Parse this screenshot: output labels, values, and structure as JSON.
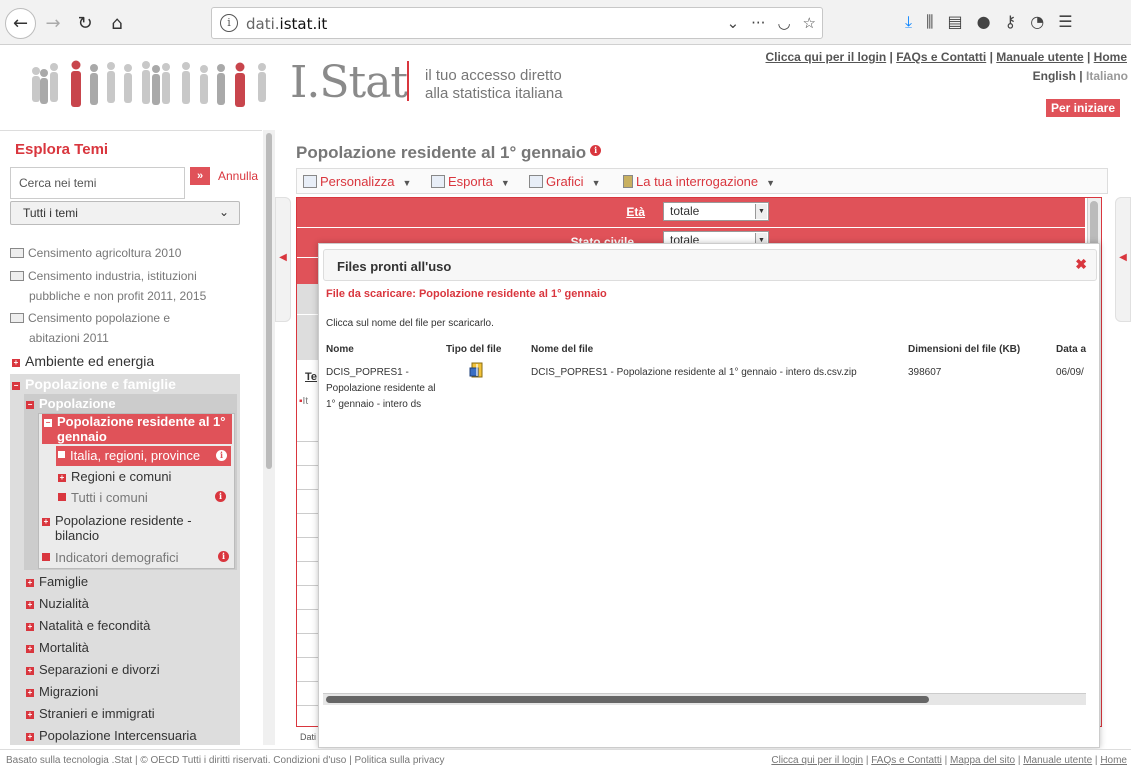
{
  "browser": {
    "url_prefix": "dati.",
    "url_domain": "istat.it",
    "url_icons": [
      "chevron-down-icon",
      "ellipsis-icon",
      "pocket-icon",
      "star-icon"
    ],
    "toolbar_icons": [
      "download-icon",
      "library-icon",
      "sidebar-icon",
      "extension-icon",
      "key-icon",
      "speedometer-icon",
      "menu-icon"
    ]
  },
  "header": {
    "logo": "I.Stat",
    "tagline_line1": "il tuo accesso diretto",
    "tagline_line2": "alla statistica italiana",
    "top_links": [
      "Clicca qui per il login",
      "FAQs e Contatti",
      "Manuale utente",
      "Home"
    ],
    "lang_en": "English",
    "lang_it": "Italiano",
    "start_button": "Per iniziare"
  },
  "sidebar": {
    "title": "Esplora Temi",
    "search_placeholder": "Cerca nei temi",
    "go_label": "»",
    "cancel_label": "Annulla",
    "select_value": "Tutti i temi",
    "census": [
      "Censimento agricoltura 2010",
      "Censimento industria, istituzioni",
      "pubbliche e non profit 2011, 2015",
      "Censimento popolazione e",
      "abitazioni 2011"
    ],
    "topics": {
      "ambiente": "Ambiente ed energia",
      "popolazione_famiglie": "Popolazione e famiglie",
      "popolazione": "Popolazione",
      "pop_residente": "Popolazione residente al 1°",
      "pop_residente_2": "gennaio",
      "italia": "Italia, regioni, province",
      "regioni": "Regioni e comuni",
      "comuni": "Tutti i comuni",
      "bilancio_1": "Popolazione residente -",
      "bilancio_2": "bilancio",
      "indicatori": "Indicatori demografici",
      "famiglie": "Famiglie",
      "nuzialita": "Nuzialità",
      "natalita": "Natalità e fecondità",
      "mortalita": "Mortalità",
      "separazioni": "Separazioni e divorzi",
      "migrazioni": "Migrazioni",
      "stranieri": "Stranieri e immigrati",
      "intercensuaria": "Popolazione Intercensuaria"
    }
  },
  "main": {
    "title": "Popolazione residente al 1° gennaio",
    "tools": [
      "Personalizza",
      "Esporta",
      "Grafici",
      "La tua interrogazione"
    ],
    "dim1_label": "Età",
    "dim1_value": "totale",
    "dim2_label": "Stato civile",
    "dim2_value": "totale",
    "partial_te": "Te",
    "partial_it": "It",
    "footnote": "Dati"
  },
  "modal": {
    "title": "Files pronti all'uso",
    "close": "✖",
    "subtitle": "File da scaricare: Popolazione residente al 1° gennaio",
    "hint": "Clicca sul nome del file per scaricarlo.",
    "columns": [
      "Nome",
      "Tipo del file",
      "Nome del file",
      "Dimensioni del file (KB)",
      "Data a"
    ],
    "rows": [
      {
        "name": "DCIS_POPRES1 - Popolazione residente al 1° gennaio - intero ds",
        "file_name": "DCIS_POPRES1 - Popolazione residente al 1° gennaio - intero ds.csv.zip",
        "size_kb": "398607",
        "date": "06/09/"
      }
    ]
  },
  "footer": {
    "left": "Basato sulla tecnologia .Stat | © OECD Tutti i diritti riservati. Condizioni d'uso |  Politica sulla privacy",
    "right_links": [
      "Clicca qui per il login",
      "FAQs e Contatti",
      "Mappa del sito",
      "Manuale utente",
      "Home"
    ]
  },
  "colors": {
    "accent": "#d9363e",
    "accent_bg": "#e05259",
    "grey_panel": "#dddddd"
  }
}
